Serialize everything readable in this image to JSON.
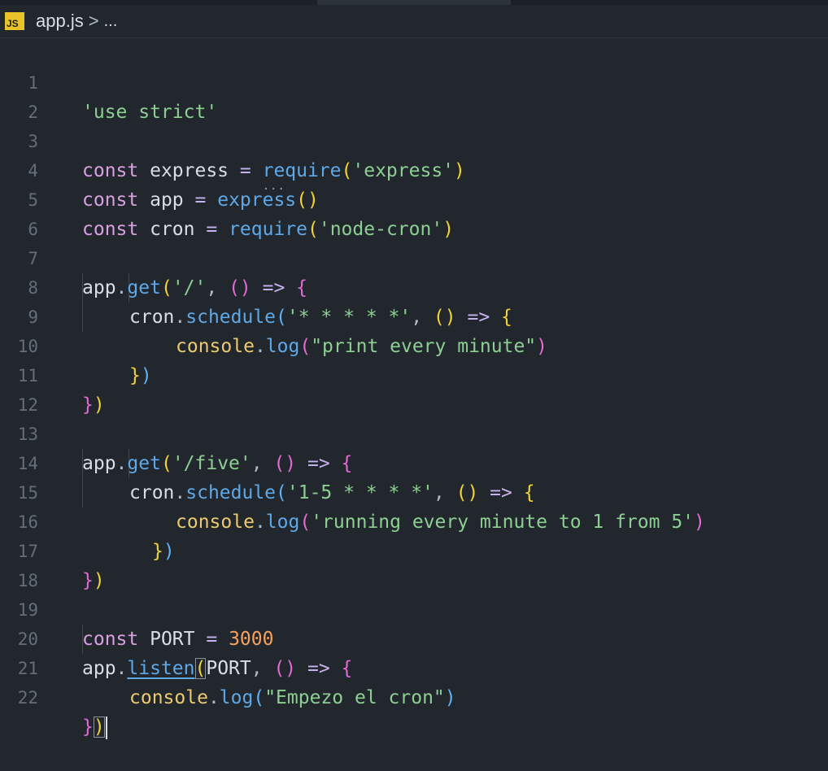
{
  "breadcrumb": {
    "icon_label": "JS",
    "file": "app.js",
    "separator": ">",
    "more": "..."
  },
  "colors": {
    "background": "#22272e",
    "keyword": "#d8a0e0",
    "function": "#5fa8e8",
    "string": "#8dcf92",
    "number": "#f4a261"
  },
  "line_numbers": [
    "1",
    "2",
    "3",
    "4",
    "5",
    "6",
    "7",
    "8",
    "9",
    "10",
    "11",
    "12",
    "13",
    "14",
    "15",
    "16",
    "17",
    "18",
    "19",
    "20",
    "21",
    "22"
  ],
  "code": {
    "l1": {
      "s1": "'use strict'"
    },
    "l3": {
      "k": "const",
      "v": " express ",
      "op": "=",
      "f": "require",
      "p1": "(",
      "s": "'express'",
      "p2": ")"
    },
    "l4": {
      "k": "const",
      "v": " app ",
      "op": "=",
      "f": "express",
      "p": "()"
    },
    "l5": {
      "k": "const",
      "v": " cron ",
      "op": "=",
      "f": "require",
      "p1": "(",
      "s": "'node-cron'",
      "p2": ")"
    },
    "l7": {
      "o": "app",
      "d": ".",
      "f": "get",
      "p1": "(",
      "s": "'/'",
      "c": ", ",
      "pa": "()",
      "ar": " => ",
      "br": "{"
    },
    "l8": {
      "o": "cron",
      "d": ".",
      "f": "schedule",
      "p1": "(",
      "s": "'* * * * *'",
      "c": ", ",
      "pa": "()",
      "ar": " => ",
      "br": "{"
    },
    "l9": {
      "o": "console",
      "d": ".",
      "f": "log",
      "p1": "(",
      "s": "\"print every minute\"",
      "p2": ")"
    },
    "l10": {
      "b1": "}",
      "b2": ")"
    },
    "l11": {
      "b1": "}",
      "b2": ")"
    },
    "l13": {
      "o": "app",
      "d": ".",
      "f": "get",
      "p1": "(",
      "s": "'/five'",
      "c": ", ",
      "pa": "()",
      "ar": " => ",
      "br": "{"
    },
    "l14": {
      "o": "cron",
      "d": ".",
      "f": "schedule",
      "p1": "(",
      "s": "'1-5 * * * *'",
      "c": ", ",
      "pa": "()",
      "ar": " => ",
      "br": "{"
    },
    "l15": {
      "o": "console",
      "d": ".",
      "f": "log",
      "p1": "(",
      "s": "'running every minute to 1 from 5'",
      "p2": ")"
    },
    "l16": {
      "b1": "}",
      "b2": ")"
    },
    "l17": {
      "b1": "}",
      "b2": ")"
    },
    "l19": {
      "k": "const",
      "v": " PORT ",
      "op": "=",
      "n": "3000"
    },
    "l20": {
      "o": "app",
      "d": ".",
      "f": "listen",
      "p1": "(",
      "a": "PORT",
      "c": ", ",
      "pa": "()",
      "ar": " => ",
      "br": "{"
    },
    "l21": {
      "o": "console",
      "d": ".",
      "f": "log",
      "p1": "(",
      "s": "\"Empezo el cron\"",
      "p2": ")"
    },
    "l22": {
      "b1": "}",
      "b2": ")"
    }
  }
}
